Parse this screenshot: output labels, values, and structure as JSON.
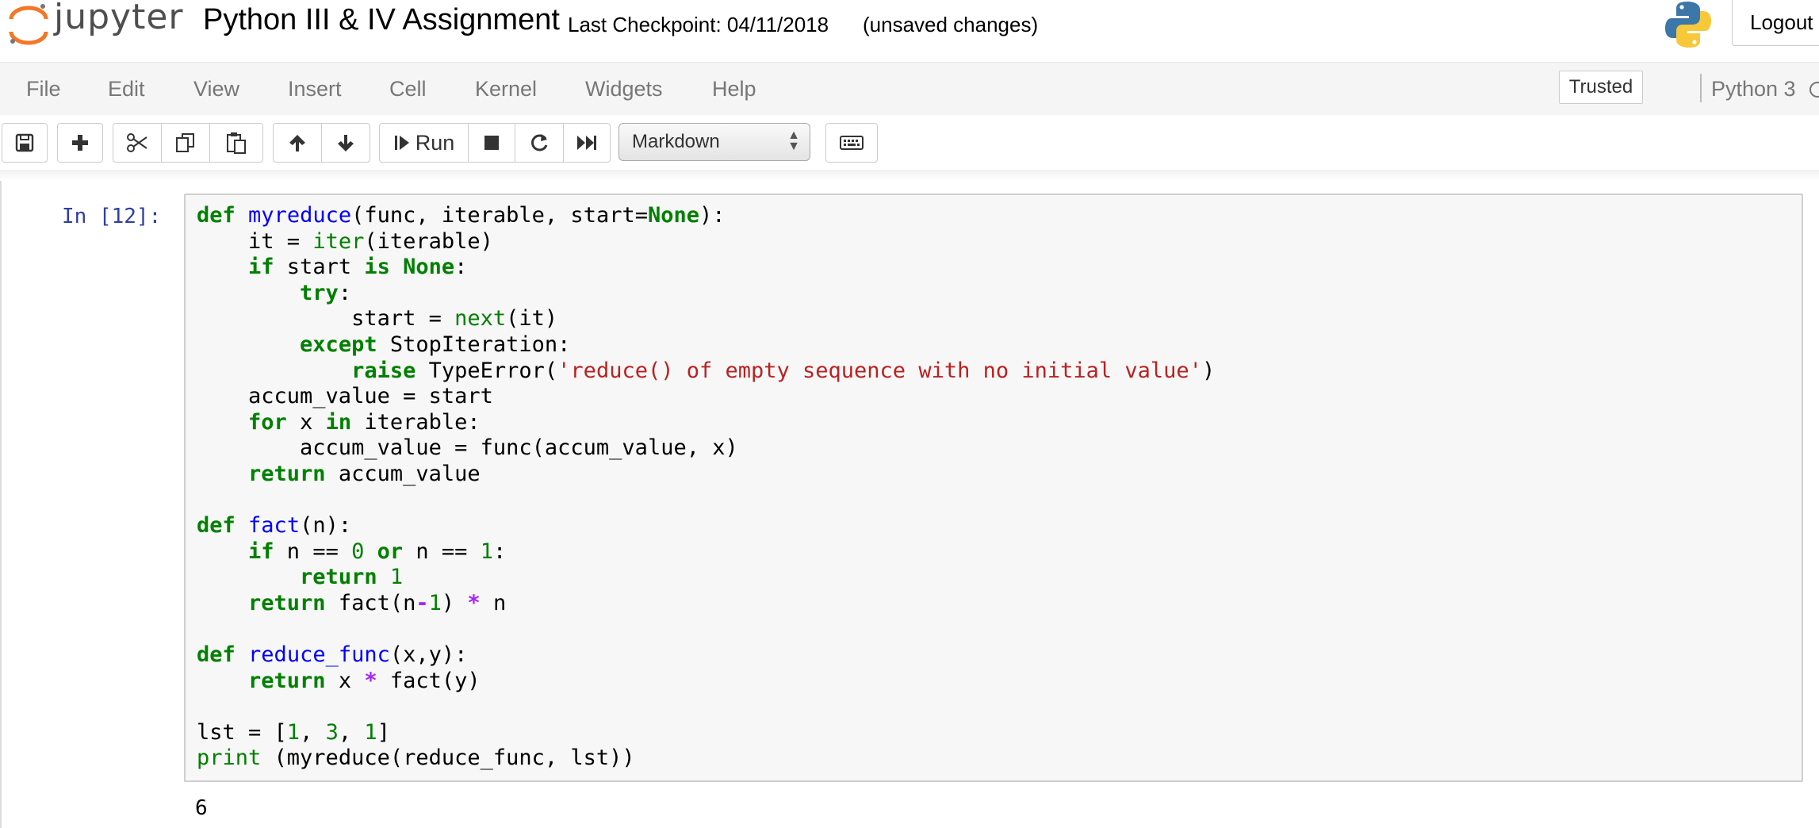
{
  "header": {
    "logo_text": "jupyter",
    "notebook_title": "Python III & IV Assignment",
    "checkpoint": "Last Checkpoint: 04/11/2018",
    "unsaved": "(unsaved changes)",
    "logout_label": "Logout"
  },
  "menubar": {
    "items": [
      "File",
      "Edit",
      "View",
      "Insert",
      "Cell",
      "Kernel",
      "Widgets",
      "Help"
    ],
    "trusted_label": "Trusted",
    "kernel_name": "Python 3"
  },
  "toolbar": {
    "run_label": "Run",
    "cell_type": "Markdown",
    "icons": [
      "save-icon",
      "plus-icon",
      "scissors-icon",
      "copy-icon",
      "paste-icon",
      "arrow-up-icon",
      "arrow-down-icon",
      "run-icon",
      "stop-icon",
      "restart-icon",
      "fast-forward-icon",
      "keyboard-icon"
    ]
  },
  "cell": {
    "prompt": "In [12]:",
    "code_lines": [
      [
        [
          "k",
          "def"
        ],
        [
          "t",
          " "
        ],
        [
          "f",
          "myreduce"
        ],
        [
          "t",
          "(func, iterable, start="
        ],
        [
          "k",
          "None"
        ],
        [
          "t",
          "):"
        ]
      ],
      [
        [
          "t",
          "    it = "
        ],
        [
          "b",
          "iter"
        ],
        [
          "t",
          "(iterable)"
        ]
      ],
      [
        [
          "t",
          "    "
        ],
        [
          "k",
          "if"
        ],
        [
          "t",
          " start "
        ],
        [
          "k",
          "is"
        ],
        [
          "t",
          " "
        ],
        [
          "k",
          "None"
        ],
        [
          "t",
          ":"
        ]
      ],
      [
        [
          "t",
          "        "
        ],
        [
          "k",
          "try"
        ],
        [
          "t",
          ":"
        ]
      ],
      [
        [
          "t",
          "            start = "
        ],
        [
          "b",
          "next"
        ],
        [
          "t",
          "(it)"
        ]
      ],
      [
        [
          "t",
          "        "
        ],
        [
          "k",
          "except"
        ],
        [
          "t",
          " StopIteration:"
        ]
      ],
      [
        [
          "t",
          "            "
        ],
        [
          "k",
          "raise"
        ],
        [
          "t",
          " TypeError("
        ],
        [
          "s",
          "'reduce() of empty sequence with no initial value'"
        ],
        [
          "t",
          ")"
        ]
      ],
      [
        [
          "t",
          "    accum_value = start"
        ]
      ],
      [
        [
          "t",
          "    "
        ],
        [
          "k",
          "for"
        ],
        [
          "t",
          " x "
        ],
        [
          "k",
          "in"
        ],
        [
          "t",
          " iterable:"
        ]
      ],
      [
        [
          "t",
          "        accum_value = func(accum_value, x)"
        ]
      ],
      [
        [
          "t",
          "    "
        ],
        [
          "k",
          "return"
        ],
        [
          "t",
          " accum_value"
        ]
      ],
      [
        [
          "t",
          ""
        ]
      ],
      [
        [
          "k",
          "def"
        ],
        [
          "t",
          " "
        ],
        [
          "f",
          "fact"
        ],
        [
          "t",
          "(n):"
        ]
      ],
      [
        [
          "t",
          "    "
        ],
        [
          "k",
          "if"
        ],
        [
          "t",
          " n == "
        ],
        [
          "n",
          "0"
        ],
        [
          "t",
          " "
        ],
        [
          "k",
          "or"
        ],
        [
          "t",
          " n == "
        ],
        [
          "n",
          "1"
        ],
        [
          "t",
          ":"
        ]
      ],
      [
        [
          "t",
          "        "
        ],
        [
          "k",
          "return"
        ],
        [
          "t",
          " "
        ],
        [
          "n",
          "1"
        ]
      ],
      [
        [
          "t",
          "    "
        ],
        [
          "k",
          "return"
        ],
        [
          "t",
          " fact(n"
        ],
        [
          "o",
          "-"
        ],
        [
          "n",
          "1"
        ],
        [
          "t",
          ") "
        ],
        [
          "o",
          "*"
        ],
        [
          "t",
          " n"
        ]
      ],
      [
        [
          "t",
          ""
        ]
      ],
      [
        [
          "k",
          "def"
        ],
        [
          "t",
          " "
        ],
        [
          "f",
          "reduce_func"
        ],
        [
          "t",
          "(x,y):"
        ]
      ],
      [
        [
          "t",
          "    "
        ],
        [
          "k",
          "return"
        ],
        [
          "t",
          " x "
        ],
        [
          "o",
          "*"
        ],
        [
          "t",
          " fact(y)"
        ]
      ],
      [
        [
          "t",
          ""
        ]
      ],
      [
        [
          "t",
          "lst = ["
        ],
        [
          "n",
          "1"
        ],
        [
          "t",
          ", "
        ],
        [
          "n",
          "3"
        ],
        [
          "t",
          ", "
        ],
        [
          "n",
          "1"
        ],
        [
          "t",
          "]"
        ]
      ],
      [
        [
          "b",
          "print"
        ],
        [
          "t",
          " (myreduce(reduce_func, lst))"
        ]
      ]
    ],
    "output": "6"
  }
}
